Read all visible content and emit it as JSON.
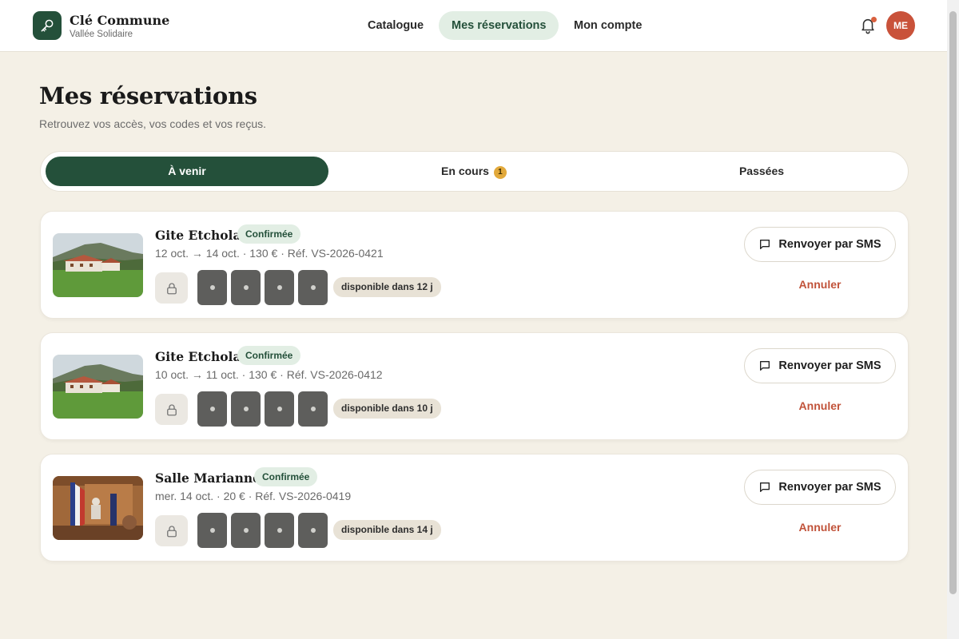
{
  "app": {
    "brand_title": "Clé Commune",
    "brand_subtitle": "Vallée Solidaire",
    "logo_icon": "key-icon",
    "accent_color": "#24503a"
  },
  "nav": {
    "items": [
      {
        "label": "Catalogue",
        "active": false
      },
      {
        "label": "Mes réservations",
        "active": true
      },
      {
        "label": "Mon compte",
        "active": false
      }
    ],
    "notification_icon": "bell-icon",
    "has_unread_notification": true,
    "avatar_initials": "ME"
  },
  "page": {
    "title": "Mes réservations",
    "subtitle": "Retrouvez vos accès, vos codes et vos reçus."
  },
  "tabs": [
    {
      "label": "À venir",
      "active": true,
      "badge": ""
    },
    {
      "label": "En cours",
      "active": false,
      "badge": "1"
    },
    {
      "label": "Passées",
      "active": false,
      "badge": ""
    }
  ],
  "reservations": [
    {
      "title": "Gite Etchola",
      "status": "Confirmée",
      "meta": "12 oct. → 14 oct. · 130 € · Réf. VS-2026-0421",
      "availability": "disponible dans 12 j",
      "image_icon": "house-photo",
      "sms_label": "Renvoyer par SMS",
      "cancel_label": "Annuler"
    },
    {
      "title": "Gite Etchola",
      "status": "Confirmée",
      "meta": "10 oct. → 11 oct. · 130 € · Réf. VS-2026-0412",
      "availability": "disponible dans 10 j",
      "image_icon": "house-photo",
      "sms_label": "Renvoyer par SMS",
      "cancel_label": "Annuler"
    },
    {
      "title": "Salle Marianne",
      "status": "Confirmée",
      "meta": "mer. 14 oct. · 20 € · Réf. VS-2026-0419",
      "availability": "disponible dans 14 j",
      "image_icon": "hall-photo",
      "sms_label": "Renvoyer par SMS",
      "cancel_label": "Annuler"
    }
  ]
}
